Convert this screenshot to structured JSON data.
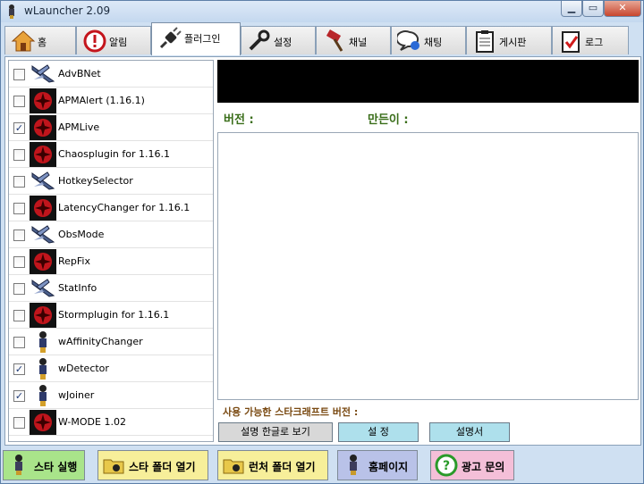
{
  "window": {
    "title": "wLauncher 2.09"
  },
  "tabs": [
    {
      "label": "홈",
      "icon": "home-icon"
    },
    {
      "label": "알림",
      "icon": "alert-icon"
    },
    {
      "label": "플러그인",
      "icon": "plug-icon",
      "active": true
    },
    {
      "label": "설정",
      "icon": "wrench-icon"
    },
    {
      "label": "채널",
      "icon": "hammer-icon"
    },
    {
      "label": "채팅",
      "icon": "chat-search-icon"
    },
    {
      "label": "게시판",
      "icon": "clipboard-icon"
    },
    {
      "label": "로그",
      "icon": "log-check-icon"
    }
  ],
  "plugins": [
    {
      "name": "AdvBNet",
      "checked": false,
      "icon": "jet-icon"
    },
    {
      "name": "APMAlert (1.16.1)",
      "checked": false,
      "icon": "red-star-icon"
    },
    {
      "name": "APMLive",
      "checked": true,
      "icon": "red-star-icon"
    },
    {
      "name": "Chaosplugin for 1.16.1",
      "checked": false,
      "icon": "red-star-icon"
    },
    {
      "name": "HotkeySelector",
      "checked": false,
      "icon": "jet-icon"
    },
    {
      "name": "LatencyChanger for 1.16.1",
      "checked": false,
      "icon": "red-star-icon"
    },
    {
      "name": "ObsMode",
      "checked": false,
      "icon": "jet-icon"
    },
    {
      "name": "RepFix",
      "checked": false,
      "icon": "red-star-icon"
    },
    {
      "name": "StatInfo",
      "checked": false,
      "icon": "jet-icon"
    },
    {
      "name": "Stormplugin for 1.16.1",
      "checked": false,
      "icon": "red-star-icon"
    },
    {
      "name": "wAffinityChanger",
      "checked": false,
      "icon": "figure-icon"
    },
    {
      "name": "wDetector",
      "checked": true,
      "icon": "figure-icon"
    },
    {
      "name": "wJoiner",
      "checked": true,
      "icon": "figure-icon"
    },
    {
      "name": "W-MODE 1.02",
      "checked": false,
      "icon": "red-star-icon"
    }
  ],
  "details": {
    "version_label": "버전 :",
    "author_label": "만든이 :",
    "sc_version_label": "사용 가능한 스타크래프트 버전 :"
  },
  "actions": {
    "korean_desc": "설명 한글로 보기",
    "settings": "설  정",
    "manual": "설명서"
  },
  "bottom": {
    "run_star": "스타 실행",
    "open_star_folder": "스타 폴더 열기",
    "open_launcher_folder": "런처 폴더 열기",
    "homepage": "홈페이지",
    "ad_inquiry": "광고 문의"
  },
  "colors": {
    "green_button": "#a9e48a",
    "yellow_button": "#f7ef9a",
    "lavender_button": "#b9c2e8",
    "pink_button": "#f4bfd8",
    "cyan_button": "#aee0ec",
    "label_green": "#3a6e1a"
  }
}
